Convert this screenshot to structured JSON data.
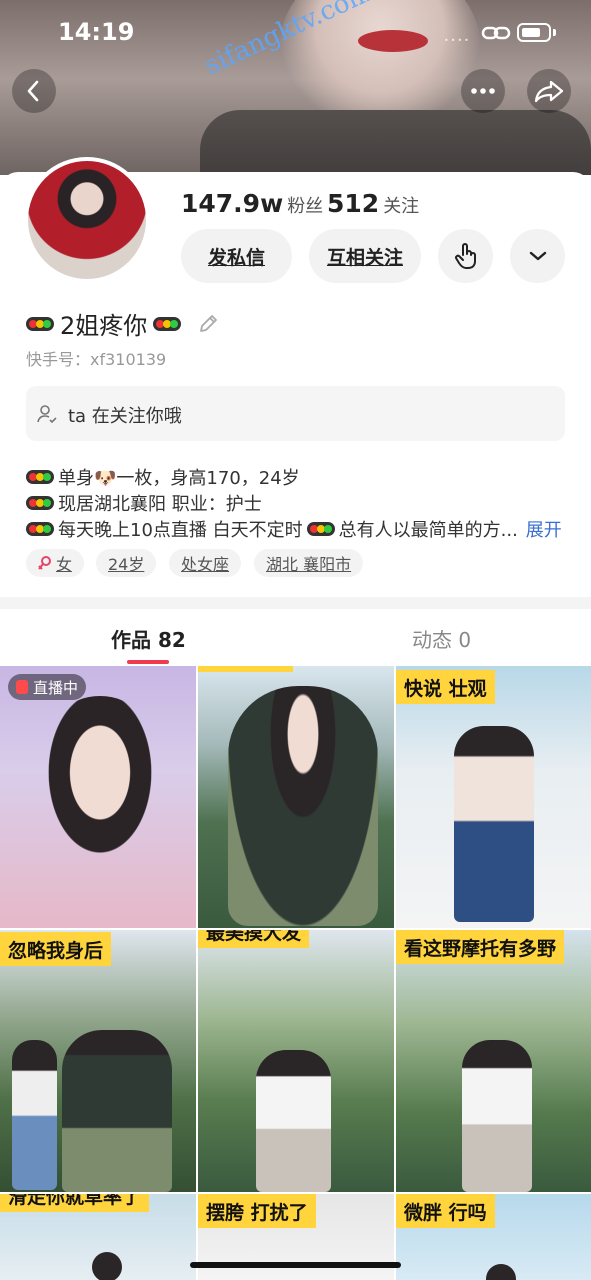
{
  "status_bar": {
    "time": "14:19",
    "signal": "••••"
  },
  "watermark": "sifangktv.com",
  "profile": {
    "fans_count": "147.9w",
    "fans_label": "粉丝",
    "following_count": "512",
    "following_label": "关注",
    "message_button": "发私信",
    "mutual_follow_button": "互相关注",
    "name": "2姐疼你",
    "kuaishou_id": "快手号：xf310139",
    "follow_notice": "ta 在关注你哦"
  },
  "bio": {
    "line1": "单身🐶一枚，身高170，24岁",
    "line2": "现居湖北襄阳   职业：护士",
    "line3a": "每天晚上10点直播  白天不定时",
    "line3b": "总有人以最简单的方...",
    "expand": "展开"
  },
  "tags": [
    "女",
    "24岁",
    "处女座",
    "湖北 襄阳市"
  ],
  "tabs": {
    "works": "作品 82",
    "moments": "动态 0"
  },
  "grid": [
    {
      "badge": "直播中",
      "caption": ""
    },
    {
      "badge": "",
      "caption": ""
    },
    {
      "badge": "",
      "caption": "快说 壮观"
    },
    {
      "badge": "",
      "caption": "忽略我身后"
    },
    {
      "badge": "",
      "caption": "最美摸大发"
    },
    {
      "badge": "",
      "caption": "看这野摩托有多野"
    },
    {
      "badge": "",
      "caption": "滑走你就草率了"
    },
    {
      "badge": "",
      "caption": "摆胯 打扰了"
    },
    {
      "badge": "",
      "caption": "微胖 行吗"
    }
  ],
  "colors": {
    "accent": "#ef3b4f",
    "caption_bg": "#ffd43d",
    "link": "#3b6fd1"
  }
}
